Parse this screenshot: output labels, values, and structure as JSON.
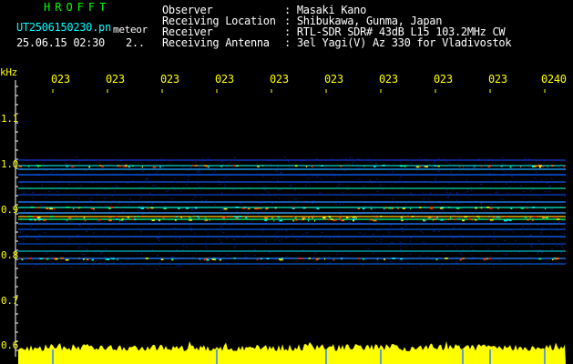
{
  "header": {
    "brand": "HROFFT",
    "file_name": "UT2506150230.pn",
    "mode": "meteor",
    "datetime": "25.06.15 02:30",
    "page_indicator": "2..",
    "labels": {
      "observer": "Observer",
      "location": "Receiving Location",
      "receiver": "Receiver",
      "antenna": "Receiving Antenna"
    },
    "values": {
      "observer": ": Masaki Kano",
      "location": ": Shibukawa, Gunma, Japan",
      "receiver": ": RTL-SDR SDR# 43dB L15 103.2MHz CW",
      "antenna": ": 3el Yagi(V) Az 330 for Vladivostok"
    }
  },
  "axis": {
    "unit": "kHz",
    "freq_ticks": [
      "1.1",
      "1.0",
      "0.9",
      "0.8",
      "0.7",
      "0.6"
    ],
    "time_ticks": [
      "023",
      "023",
      "023",
      "023",
      "023",
      "023",
      "023",
      "023",
      "023",
      "0240"
    ]
  },
  "colors": {
    "background": "#000000",
    "tick_text": "#ffff00",
    "brand": "#00ff00",
    "file_text": "#00ffff",
    "noise_band": "#ffff00",
    "tick_line": "#3080ff"
  }
}
